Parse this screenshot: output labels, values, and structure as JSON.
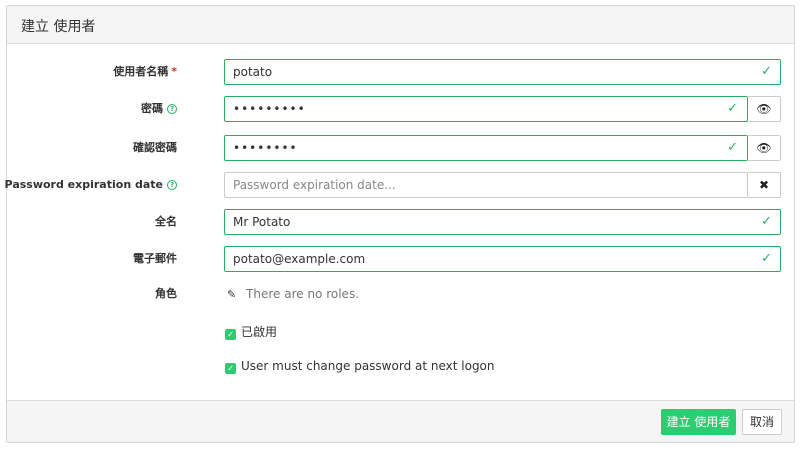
{
  "header": {
    "title": "建立 使用者"
  },
  "form": {
    "username": {
      "label": "使用者名稱",
      "required_mark": "*",
      "value": "potato"
    },
    "password": {
      "label": "密碼",
      "value": "•••••••••"
    },
    "confirm_password": {
      "label": "確認密碼",
      "value": "••••••••"
    },
    "expiration": {
      "label": "Password expiration date",
      "placeholder": "Password expiration date..."
    },
    "full_name": {
      "label": "全名",
      "value": "Mr Potato"
    },
    "email": {
      "label": "電子郵件",
      "value": "potato@example.com"
    },
    "roles": {
      "label": "角色",
      "empty_text": "There are no roles."
    },
    "enabled": {
      "label": "已啟用",
      "checked": true
    },
    "must_change": {
      "label": "User must change password at next logon",
      "checked": true
    }
  },
  "footer": {
    "create_label": "建立 使用者",
    "cancel_label": "取消"
  },
  "icons": {
    "help": "?",
    "check": "✓",
    "eye": "👁",
    "clear": "✖",
    "pencil": "✎"
  },
  "colors": {
    "accent": "#2ecc71",
    "valid_border": "#27ae60",
    "required": "#c0392b"
  }
}
